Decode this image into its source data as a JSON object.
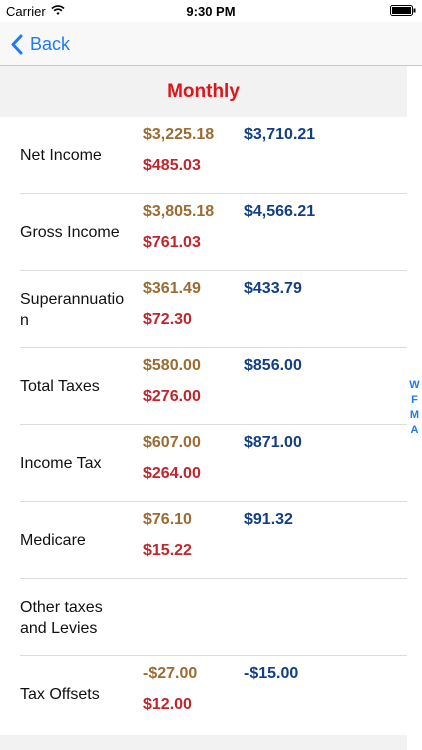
{
  "status_bar": {
    "carrier": "Carrier",
    "time": "9:30 PM"
  },
  "nav": {
    "back_label": "Back"
  },
  "section": {
    "title": "Monthly"
  },
  "rows": [
    {
      "label": "Net Income",
      "brown": "$3,225.18",
      "blue": "$3,710.21",
      "red": "$485.03"
    },
    {
      "label": "Gross Income",
      "brown": "$3,805.18",
      "blue": "$4,566.21",
      "red": "$761.03"
    },
    {
      "label": "Superannuation",
      "brown": "$361.49",
      "blue": "$433.79",
      "red": "$72.30"
    },
    {
      "label": "Total Taxes",
      "brown": "$580.00",
      "blue": "$856.00",
      "red": "$276.00"
    },
    {
      "label": "Income Tax",
      "brown": "$607.00",
      "blue": "$871.00",
      "red": "$264.00"
    },
    {
      "label": "Medicare",
      "brown": "$76.10",
      "blue": "$91.32",
      "red": "$15.22"
    },
    {
      "label": "Other taxes and Levies",
      "brown": "",
      "blue": "",
      "red": ""
    },
    {
      "label": "Tax Offsets",
      "brown": "-$27.00",
      "blue": "-$15.00",
      "red": "$12.00"
    }
  ],
  "section_index": [
    "W",
    "F",
    "M",
    "A"
  ],
  "colors": {
    "accent": "#1d7cf2",
    "title_red": "#e0141b",
    "brown": "#9b6b32",
    "blue": "#123e84",
    "red": "#c0252b"
  }
}
